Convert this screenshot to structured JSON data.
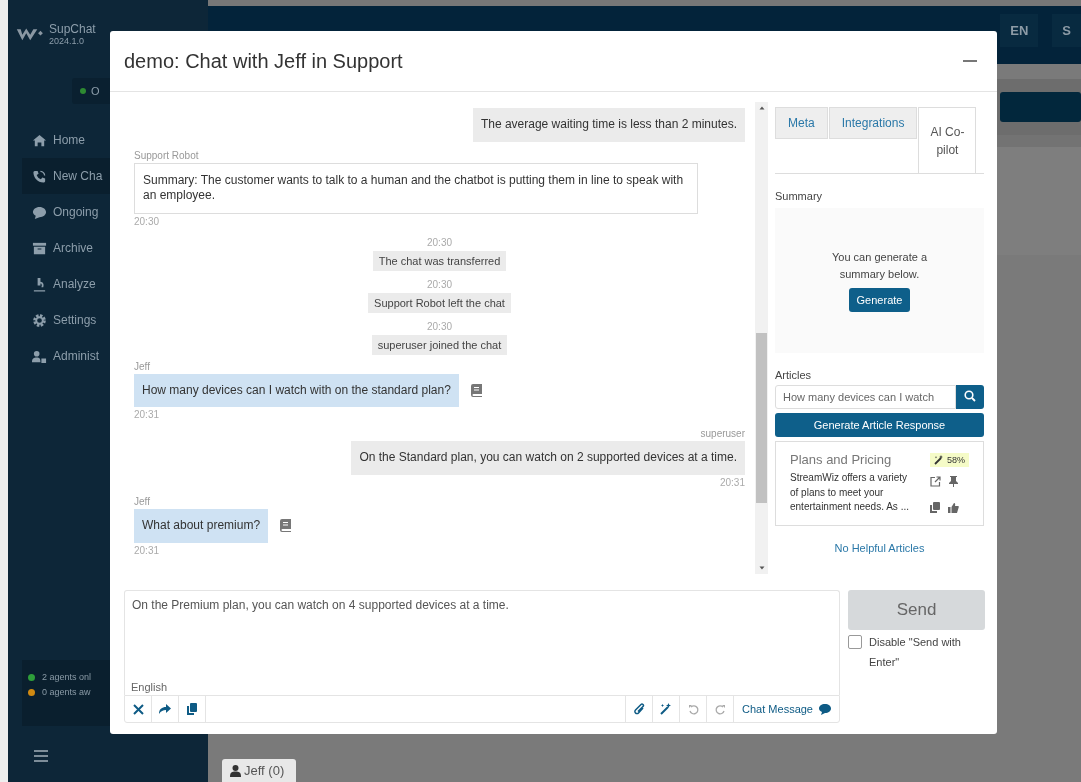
{
  "app": {
    "name": "SupChat",
    "version": "2024.1.0",
    "status": "O",
    "nav": [
      {
        "label": "Home",
        "kind": "home",
        "selected": false
      },
      {
        "label": "New Cha",
        "kind": "phone",
        "selected": true
      },
      {
        "label": "Ongoing",
        "kind": "chat",
        "selected": false
      },
      {
        "label": "Archive",
        "kind": "archive",
        "selected": false
      },
      {
        "label": "Analyze",
        "kind": "microscope",
        "selected": false
      },
      {
        "label": "Settings",
        "kind": "gear",
        "selected": false
      },
      {
        "label": "Administ",
        "kind": "users",
        "selected": false
      }
    ],
    "agents": [
      {
        "text": "2 agents onl",
        "color": "#2e9e3a"
      },
      {
        "text": "0 agents aw",
        "color": "#d08a12"
      }
    ],
    "top_buttons": [
      "EN",
      "S"
    ],
    "bottom_tab": "Jeff (0)"
  },
  "dialog": {
    "title": "demo: Chat with Jeff in Support",
    "messages": [
      {
        "kind": "agent",
        "text": "The average waiting time is less than 2 minutes."
      },
      {
        "kind": "bot",
        "sender": "Support Robot",
        "text": "Summary: The customer wants to talk to a human and the chatbot is putting them in line to speak with an employee.",
        "time": "20:30"
      },
      {
        "kind": "event",
        "time": "20:30",
        "text": "The chat was transferred"
      },
      {
        "kind": "event",
        "time": "20:30",
        "text": "Support Robot left the chat"
      },
      {
        "kind": "event",
        "time": "20:30",
        "text": "superuser joined the chat"
      },
      {
        "kind": "customer",
        "sender": "Jeff",
        "text": "How many devices can I watch with on the standard plan?",
        "time": "20:31"
      },
      {
        "kind": "agent",
        "sender": "superuser",
        "text": "On the Standard plan, you can watch on 2 supported devices at a time.",
        "time": "20:31"
      },
      {
        "kind": "customer",
        "sender": "Jeff",
        "text": "What about premium?",
        "time": "20:31"
      }
    ],
    "tabs": [
      {
        "label": "Meta",
        "selected": false
      },
      {
        "label": "Integrations",
        "selected": false
      },
      {
        "label": "AI Co-pilot",
        "selected": true
      }
    ],
    "summary": {
      "label": "Summary",
      "text": "You can generate a summary below.",
      "button": "Generate"
    },
    "articles": {
      "label": "Articles",
      "search_value": "How many devices can I watch",
      "button": "Generate Article Response",
      "items": [
        {
          "title": "Plans and Pricing",
          "score": "58%",
          "excerpt": "StreamWiz offers a variety of plans to meet your entertainment needs. As ..."
        }
      ],
      "none_link": "No Helpful Articles"
    },
    "composer": {
      "value": "On the Premium plan, you can watch on 4 supported devices at a time.",
      "language": "English",
      "mode": "Chat Message",
      "send": "Send",
      "send_disabled": true,
      "option": {
        "label": "Disable \"Send with Enter\"",
        "checked": false
      }
    }
  }
}
